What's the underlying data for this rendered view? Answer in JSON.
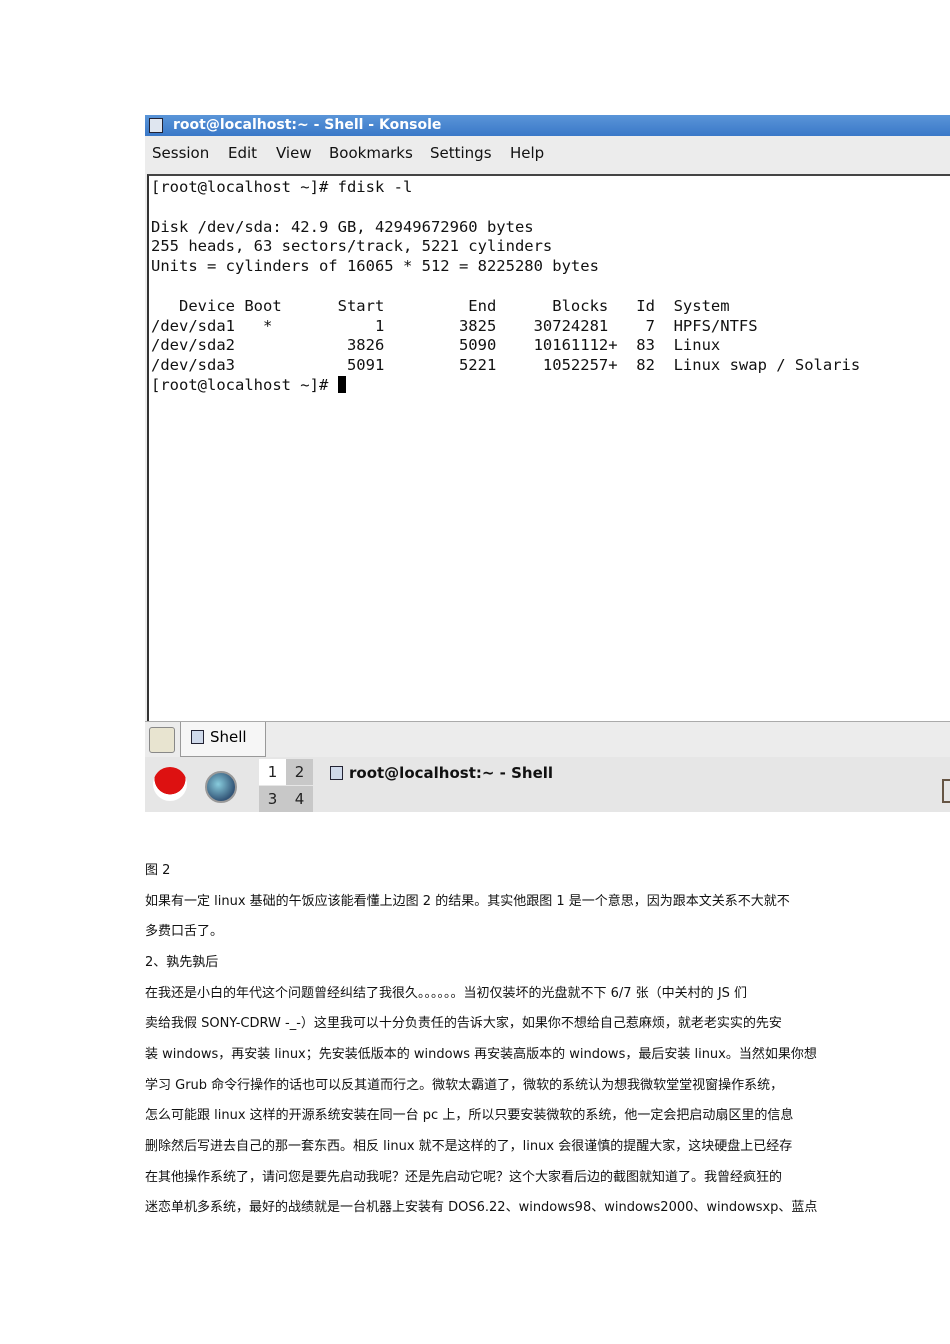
{
  "window": {
    "title": "root@localhost:~ - Shell - Konsole",
    "menu": [
      "Session",
      "Edit",
      "View",
      "Bookmarks",
      "Settings",
      "Help"
    ],
    "terminal_lines": [
      "[root@localhost ~]# fdisk -l",
      "",
      "Disk /dev/sda: 42.9 GB, 42949672960 bytes",
      "255 heads, 63 sectors/track, 5221 cylinders",
      "Units = cylinders of 16065 * 512 = 8225280 bytes",
      "",
      "   Device Boot      Start         End      Blocks   Id  System",
      "/dev/sda1   *           1        3825    30724281    7  HPFS/NTFS",
      "/dev/sda2            3826        5090    10161112+  83  Linux",
      "/dev/sda3            5091        5221     1052257+  82  Linux swap / Solaris"
    ],
    "prompt": "[root@localhost ~]# ",
    "tab_label": "Shell",
    "pager": [
      "1",
      "2",
      "3",
      "4"
    ],
    "task_label": "root@localhost:~ - Shell"
  },
  "doc": {
    "caption": "图 2",
    "lines": [
      "如果有一定 linux 基础的午饭应该能看懂上边图 2 的结果。其实他跟图 1 是一个意思，因为跟本文关系不大就不",
      "多费口舌了。",
      "2、孰先孰后",
      "在我还是小白的年代这个问题曾经纠结了我很久。。。。。。当初仅装坏的光盘就不下 6/7 张（中关村的 JS 们",
      "卖给我假 SONY-CDRW -_-）这里我可以十分负责任的告诉大家，如果你不想给自己惹麻烦，就老老实实的先安",
      "装 windows，再安装 linux；先安装低版本的 windows 再安装高版本的 windows，最后安装 linux。当然如果你想",
      "学习 Grub 命令行操作的话也可以反其道而行之。微软太霸道了，微软的系统认为想我微软堂堂视窗操作系统，",
      "怎么可能跟 linux 这样的开源系统安装在同一台 pc 上，所以只要安装微软的系统，他一定会把启动扇区里的信息",
      "删除然后写进去自己的那一套东西。相反 linux 就不是这样的了，linux 会很谨慎的提醒大家，这块硬盘上已经存",
      "在其他操作系统了，请问您是要先启动我呢？还是先启动它呢？这个大家看后边的截图就知道了。我曾经疯狂的",
      "迷恋单机多系统，最好的战绩就是一台机器上安装有 DOS6.22、windows98、windows2000、windowsxp、蓝点"
    ]
  }
}
